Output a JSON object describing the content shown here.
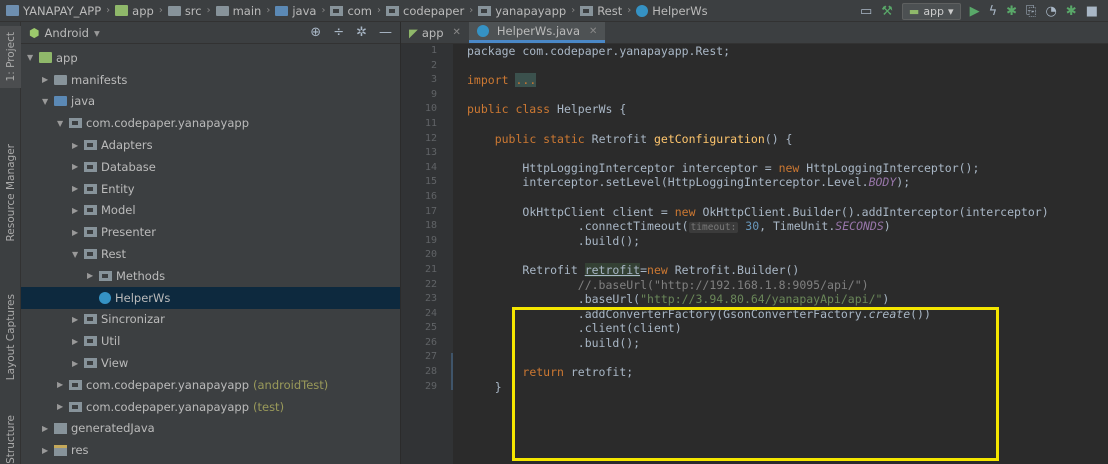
{
  "breadcrumbs": [
    "YANAPAY_APP",
    "app",
    "src",
    "main",
    "java",
    "com",
    "codepaper",
    "yanapayapp",
    "Rest",
    "HelperWs"
  ],
  "run_config": {
    "label": "app"
  },
  "left_strip_tabs": [
    "1: Project",
    "Resource Manager",
    "Layout Captures",
    "Structure"
  ],
  "panel": {
    "view_label": "Android"
  },
  "tree": [
    {
      "label": "app",
      "icon": "app-module-icon",
      "level": 0,
      "expanded": true
    },
    {
      "label": "manifests",
      "icon": "folder-icon",
      "level": 1,
      "expanded": false
    },
    {
      "label": "java",
      "icon": "folder-icon",
      "level": 1,
      "expanded": true
    },
    {
      "label": "com.codepaper.yanapayapp",
      "icon": "package-icon",
      "level": 2,
      "expanded": true
    },
    {
      "label": "Adapters",
      "icon": "package-icon",
      "level": 3,
      "expanded": false
    },
    {
      "label": "Database",
      "icon": "package-icon",
      "level": 3,
      "expanded": false
    },
    {
      "label": "Entity",
      "icon": "package-icon",
      "level": 3,
      "expanded": false
    },
    {
      "label": "Model",
      "icon": "package-icon",
      "level": 3,
      "expanded": false
    },
    {
      "label": "Presenter",
      "icon": "package-icon",
      "level": 3,
      "expanded": false
    },
    {
      "label": "Rest",
      "icon": "package-icon",
      "level": 3,
      "expanded": true
    },
    {
      "label": "Methods",
      "icon": "package-icon",
      "level": 4,
      "expanded": false
    },
    {
      "label": "HelperWs",
      "icon": "class-icon",
      "level": 4,
      "selected": true
    },
    {
      "label": "Sincronizar",
      "icon": "package-icon",
      "level": 3,
      "expanded": false
    },
    {
      "label": "Util",
      "icon": "package-icon",
      "level": 3,
      "expanded": false
    },
    {
      "label": "View",
      "icon": "package-icon",
      "level": 3,
      "expanded": false
    },
    {
      "label": "com.codepaper.yanapayapp",
      "suffix": "(androidTest)",
      "icon": "package-icon",
      "level": 2,
      "expanded": false
    },
    {
      "label": "com.codepaper.yanapayapp",
      "suffix": "(test)",
      "icon": "package-icon",
      "level": 2,
      "expanded": false
    },
    {
      "label": "generatedJava",
      "icon": "generated-folder-icon",
      "level": 1,
      "expanded": false
    },
    {
      "label": "res",
      "icon": "res-folder-icon",
      "level": 1,
      "expanded": false
    }
  ],
  "editor_tabs": [
    {
      "label": "app",
      "active": false
    },
    {
      "label": "HelperWs.java",
      "active": true
    }
  ],
  "line_numbers": [
    "1",
    "2",
    "3",
    "9",
    "10",
    "11",
    "12",
    "13",
    "14",
    "15",
    "16",
    "17",
    "18",
    "19",
    "20",
    "21",
    "22",
    "23",
    "24",
    "25",
    "26",
    "27",
    "28",
    "29"
  ],
  "code": {
    "l1": [
      "package com.codepaper.yanapayapp.Rest;"
    ],
    "l3": [
      "import",
      "..."
    ],
    "l10": [
      "public class",
      "HelperWs {"
    ],
    "l12": [
      "public static",
      "Retrofit",
      "getConfiguration",
      "() {"
    ],
    "l14a": [
      "HttpLoggingInterceptor interceptor = ",
      "new",
      "HttpLoggingInterceptor();"
    ],
    "l14b": [
      "interceptor.setLevel(HttpLoggingInterceptor.Level.",
      "BODY",
      ");"
    ],
    "l17a": [
      "OkHttpClient client = ",
      "new",
      "OkHttpClient.Builder().addInterceptor(interceptor)"
    ],
    "l17b": [
      ".connectTimeout(",
      "timeout:",
      "30",
      ", TimeUnit.",
      "SECONDS",
      ")"
    ],
    "l17c": [
      ".build();"
    ],
    "l21": [
      "Retrofit ",
      "retrofit",
      "=",
      "new",
      " Retrofit.Builder()"
    ],
    "l22": [
      "//.baseUrl(\"http://192.168.1.8:9095/api/\")"
    ],
    "l23": [
      ".baseUrl(",
      "\"http://3.94.80.64/yanapayApi/api/\"",
      ")"
    ],
    "l24": [
      ".addConverterFactory(GsonConverterFactory.",
      "create",
      "())"
    ],
    "l25": [
      ".client(client)"
    ],
    "l26": [
      ".build();"
    ],
    "l28": [
      "return",
      " retrofit;"
    ],
    "l29": [
      "}"
    ]
  },
  "colors": {
    "highlight_box": "#f4e600",
    "keyword": "#cc7832",
    "string": "#6a8759",
    "method": "#ffc66d"
  }
}
